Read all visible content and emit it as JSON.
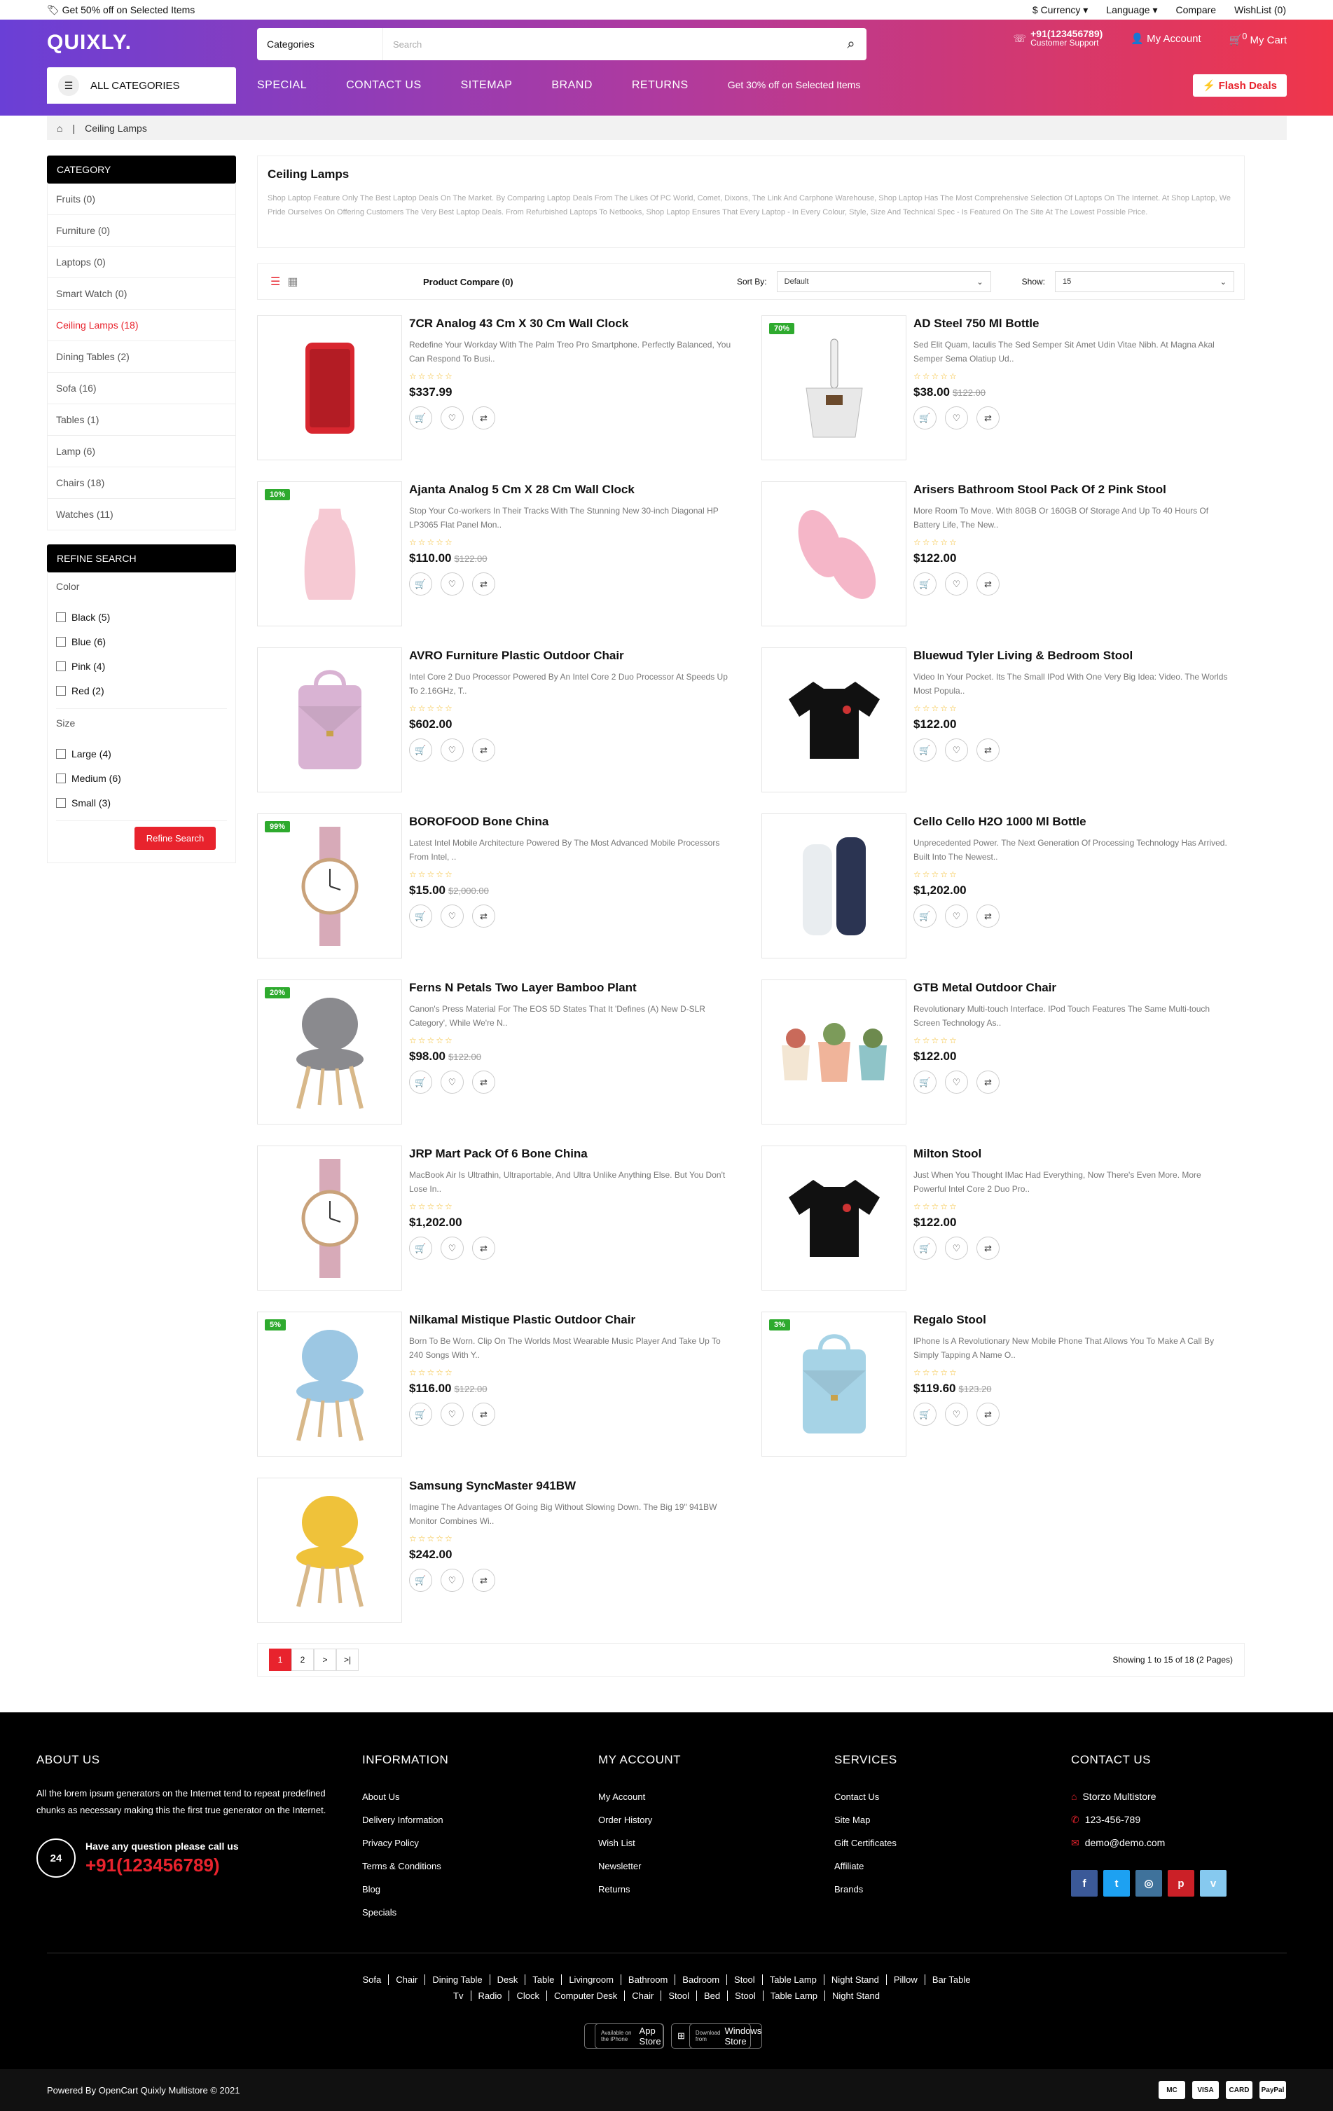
{
  "topbar": {
    "promo": "Get 50% off on Selected Items",
    "currency": "$ Currency",
    "language": "Language",
    "compare": "Compare",
    "wishlist": "WishList (0)"
  },
  "header": {
    "logo": "QUIXLY.",
    "search_category": "Categories",
    "search_placeholder": "Search",
    "support_phone": "+91(123456789)",
    "support_label": "Customer Support",
    "account": "My Account",
    "cart": "My Cart",
    "cart_count": "0"
  },
  "nav": {
    "all_categories": "ALL CATEGORIES",
    "links": [
      "SPECIAL",
      "CONTACT US",
      "SITEMAP",
      "BRAND",
      "RETURNS"
    ],
    "promo": "Get 30% off on Selected Items",
    "flash": "Flash Deals"
  },
  "breadcrumb": {
    "home_icon": "home-icon",
    "current": "Ceiling Lamps"
  },
  "sidebar": {
    "category_title": "CATEGORY",
    "categories": [
      "Fruits (0)",
      "Furniture (0)",
      "Laptops (0)",
      "Smart Watch (0)",
      "Ceiling Lamps (18)",
      "Dining Tables (2)",
      "Sofa (16)",
      "Tables (1)",
      "Lamp (6)",
      "Chairs (18)",
      "Watches (11)"
    ],
    "active_category": "Ceiling Lamps (18)",
    "refine_title": "REFINE SEARCH",
    "color_title": "Color",
    "colors": [
      "Black (5)",
      "Blue (6)",
      "Pink (4)",
      "Red (2)"
    ],
    "size_title": "Size",
    "sizes": [
      "Large (4)",
      "Medium (6)",
      "Small (3)"
    ],
    "refine_button": "Refine Search"
  },
  "category": {
    "title": "Ceiling Lamps",
    "description": "Shop Laptop Feature Only The Best Laptop Deals On The Market. By Comparing Laptop Deals From The Likes Of PC World, Comet, Dixons, The Link And Carphone Warehouse, Shop Laptop Has The Most Comprehensive Selection Of Laptops On The Internet. At Shop Laptop, We Pride Ourselves On Offering Customers The Very Best Laptop Deals. From Refurbished Laptops To Netbooks, Shop Laptop Ensures That Every Laptop - In Every Colour, Style, Size And Technical Spec - Is Featured On The Site At The Lowest Possible Price."
  },
  "toolbar": {
    "compare": "Product Compare (0)",
    "sort_label": "Sort By:",
    "sort_value": "Default",
    "show_label": "Show:",
    "show_value": "15"
  },
  "products": [
    {
      "name": "7CR Analog 43 Cm X 30 Cm Wall Clock",
      "desc": "Redefine Your Workday With The Palm Treo Pro Smartphone. Perfectly Balanced, You Can Respond To Busi..",
      "price": "$337.99",
      "old": "",
      "badge": "",
      "img": "phone",
      "color": "#d8262f"
    },
    {
      "name": "AD Steel 750 Ml Bottle",
      "desc": "Sed Elit Quam, Iaculis The Sed Semper Sit Amet Udin Vitae Nibh. At Magna Akal Semper Sema Olatiup Ud..",
      "price": "$38.00",
      "old": "$122.00",
      "badge": "70%",
      "img": "dustpan",
      "color": "#e8e8e8"
    },
    {
      "name": "Ajanta Analog 5 Cm X 28 Cm Wall Clock",
      "desc": "Stop Your Co-workers In Their Tracks With The Stunning New 30-inch Diagonal HP LP3065 Flat Panel Mon..",
      "price": "$110.00",
      "old": "$122.00",
      "badge": "10%",
      "img": "vase",
      "color": "#f6c9d3"
    },
    {
      "name": "Arisers Bathroom Stool Pack Of 2 Pink Stool",
      "desc": "More Room To Move. With 80GB Or 160GB Of Storage And Up To 40 Hours Of Battery Life, The New..",
      "price": "$122.00",
      "old": "",
      "badge": "",
      "img": "shoes",
      "color": "#f5b6c8"
    },
    {
      "name": "AVRO Furniture Plastic Outdoor Chair",
      "desc": "Intel Core 2 Duo Processor Powered By An Intel Core 2 Duo Processor At Speeds Up To 2.16GHz, T..",
      "price": "$602.00",
      "old": "",
      "badge": "",
      "img": "bag",
      "color": "#d9b3d3"
    },
    {
      "name": "Bluewud Tyler Living & Bedroom Stool",
      "desc": "Video In Your Pocket. Its The Small IPod With One Very Big Idea: Video. The Worlds Most Popula..",
      "price": "$122.00",
      "old": "",
      "badge": "",
      "img": "tshirt",
      "color": "#111111"
    },
    {
      "name": "BOROFOOD Bone China",
      "desc": "Latest Intel Mobile Architecture Powered By The Most Advanced Mobile Processors From Intel, ..",
      "price": "$15.00",
      "old": "$2,000.00",
      "badge": "99%",
      "img": "watch",
      "color": "#d7aab8"
    },
    {
      "name": "Cello Cello H2O 1000 Ml Bottle",
      "desc": "Unprecedented Power. The Next Generation Of Processing Technology Has Arrived. Built Into The Newest..",
      "price": "$1,202.00",
      "old": "",
      "badge": "",
      "img": "bottles",
      "color": "#2b3452"
    },
    {
      "name": "Ferns N Petals Two Layer Bamboo Plant",
      "desc": "Canon's Press Material For The EOS 5D States That It 'Defines (A) New D-SLR Category', While We're N..",
      "price": "$98.00",
      "old": "$122.00",
      "badge": "20%",
      "img": "chair",
      "color": "#8a8a8e"
    },
    {
      "name": "GTB Metal Outdoor Chair",
      "desc": "Revolutionary Multi-touch Interface. IPod Touch Features The Same Multi-touch Screen Technology As..",
      "price": "$122.00",
      "old": "",
      "badge": "",
      "img": "pots",
      "color": "#f0b49a"
    },
    {
      "name": "JRP Mart Pack Of 6 Bone China",
      "desc": "MacBook Air Is Ultrathin, Ultraportable, And Ultra Unlike Anything Else. But You Don't Lose In..",
      "price": "$1,202.00",
      "old": "",
      "badge": "",
      "img": "watch",
      "color": "#d7aab8"
    },
    {
      "name": "Milton Stool",
      "desc": "Just When You Thought IMac Had Everything, Now There's Even More. More Powerful Intel Core 2 Duo Pro..",
      "price": "$122.00",
      "old": "",
      "badge": "",
      "img": "tshirt",
      "color": "#111111"
    },
    {
      "name": "Nilkamal Mistique Plastic Outdoor Chair",
      "desc": "Born To Be Worn. Clip On The Worlds Most Wearable Music Player And Take Up To 240 Songs With Y..",
      "price": "$116.00",
      "old": "$122.00",
      "badge": "5%",
      "img": "chair",
      "color": "#9cc7e3"
    },
    {
      "name": "Regalo Stool",
      "desc": "IPhone Is A Revolutionary New Mobile Phone That Allows You To Make A Call By Simply Tapping A Name O..",
      "price": "$119.60",
      "old": "$123.20",
      "badge": "3%",
      "img": "bag",
      "color": "#a6d3e6"
    },
    {
      "name": "Samsung SyncMaster 941BW",
      "desc": "Imagine The Advantages Of Going Big Without Slowing Down. The Big 19\" 941BW Monitor Combines Wi..",
      "price": "$242.00",
      "old": "",
      "badge": "",
      "img": "chair",
      "color": "#efc23a"
    }
  ],
  "pagination": {
    "pages": [
      "1",
      "2",
      ">",
      ">|"
    ],
    "showing": "Showing 1 to 15 of 18 (2 Pages)"
  },
  "footer": {
    "about_title": "ABOUT US",
    "about_text": "All the lorem ipsum generators on the Internet tend to repeat predefined chunks as necessary making this the first true generator on the Internet.",
    "call_label": "Have any question please call us",
    "call_phone": "+91(123456789)",
    "info_title": "INFORMATION",
    "info_links": [
      "About Us",
      "Delivery Information",
      "Privacy Policy",
      "Terms & Conditions",
      "Blog",
      "Specials"
    ],
    "account_title": "MY ACCOUNT",
    "account_links": [
      "My Account",
      "Order History",
      "Wish List",
      "Newsletter",
      "Returns"
    ],
    "services_title": "SERVICES",
    "services_links": [
      "Contact Us",
      "Site Map",
      "Gift Certificates",
      "Affiliate",
      "Brands"
    ],
    "contact_title": "CONTACT US",
    "contact_name": "Storzo Multistore",
    "contact_phone": "123-456-789",
    "contact_email": "demo@demo.com",
    "social": [
      {
        "icon": "facebook-icon",
        "glyph": "f",
        "color": "#3b5998"
      },
      {
        "icon": "twitter-icon",
        "glyph": "t",
        "color": "#1da1f2"
      },
      {
        "icon": "instagram-icon",
        "glyph": "◎",
        "color": "#3f729b"
      },
      {
        "icon": "pinterest-icon",
        "glyph": "p",
        "color": "#cb2027"
      },
      {
        "icon": "vimeo-icon",
        "glyph": "v",
        "color": "#86c9ef"
      }
    ],
    "tags_row1": [
      "Sofa",
      "Chair",
      "Dining Table",
      "Desk",
      "Table",
      "Livingroom",
      "Bathroom",
      "Badroom",
      "Stool",
      "Table Lamp",
      "Night Stand",
      "Pillow",
      "Bar Table"
    ],
    "tags_row2": [
      "Tv",
      "Radio",
      "Clock",
      "Computer Desk",
      "Chair",
      "Stool",
      "Bed",
      "Stool",
      "Table Lamp",
      "Night Stand"
    ],
    "app1_small": "Available on the iPhone",
    "app1": "App Store",
    "app2_small": "Download from",
    "app2": "Windows Store",
    "powered": "Powered By OpenCart Quixly Multistore © 2021",
    "payments": [
      "MC",
      "VISA",
      "CARD",
      "PayPal"
    ]
  }
}
